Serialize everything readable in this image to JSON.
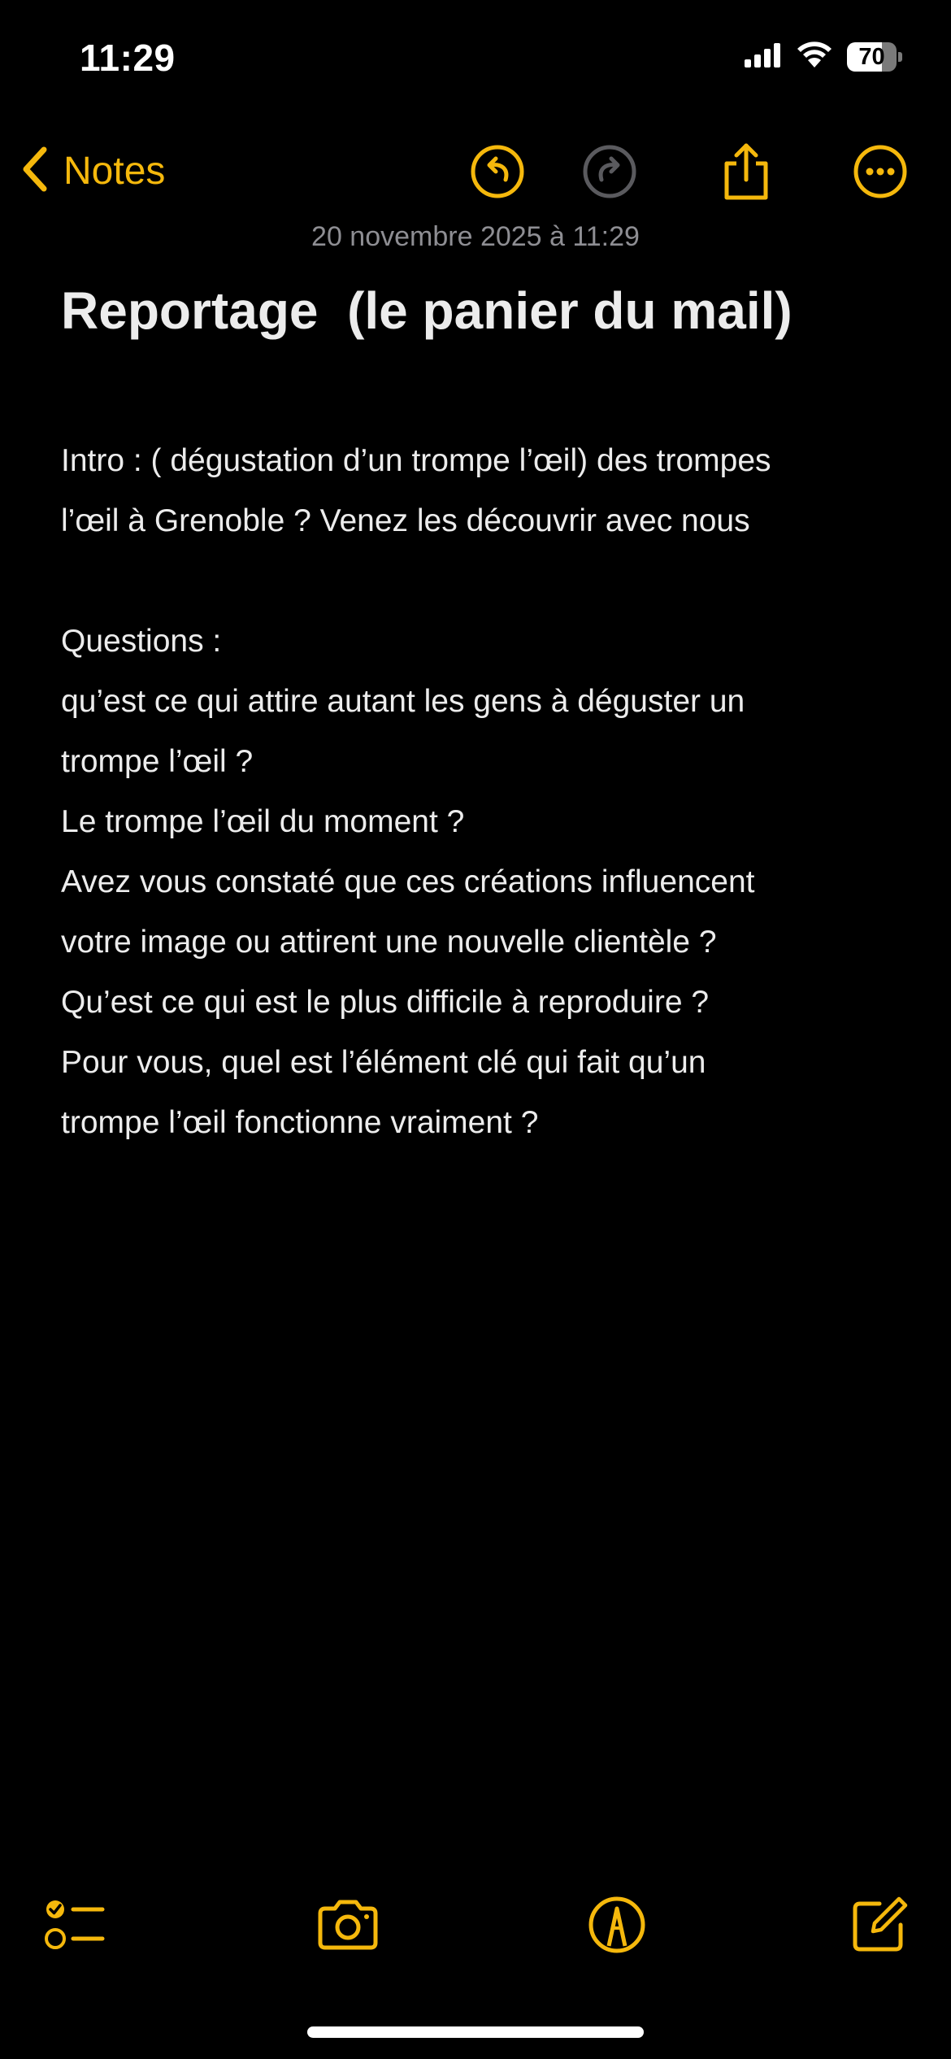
{
  "status_bar": {
    "time": "11:29",
    "battery_level": "70",
    "battery_fraction": 0.7,
    "icons": [
      "cellular-signal-icon",
      "wifi-icon",
      "battery-icon"
    ]
  },
  "nav": {
    "back_label": "Notes",
    "icons": [
      "undo-icon",
      "redo-icon",
      "share-icon",
      "more-icon"
    ],
    "accent_color": "#f5b80c",
    "disabled_color": "#5a5a5e"
  },
  "note": {
    "date": "20 novembre 2025 à 11:29",
    "title": "Reportage  (le panier du mail)",
    "lines": [
      "Intro : ( dégustation d’un trompe l’œil) des trompes",
      "l’œil à Grenoble ? Venez les découvrir avec nous",
      "",
      "Questions :",
      "qu’est ce qui attire autant les gens à déguster un",
      "trompe l’œil ?",
      "Le trompe l’œil du moment ?",
      "Avez vous constaté que ces créations influencent",
      "votre image ou attirent une nouvelle clientèle ?",
      "Qu’est ce qui est le plus difficile à reproduire ?",
      "Pour vous, quel est l’élément clé qui fait qu’un",
      "trompe l’œil fonctionne vraiment ?"
    ]
  },
  "toolbar": {
    "icons": [
      "checklist-icon",
      "camera-icon",
      "markup-icon",
      "compose-icon"
    ]
  }
}
